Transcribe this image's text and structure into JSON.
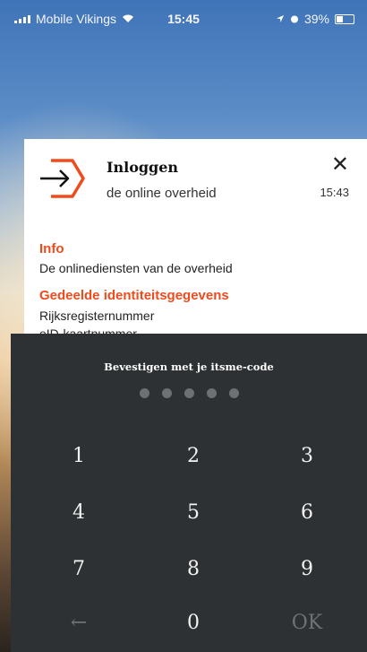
{
  "status_bar": {
    "carrier": "Mobile Vikings",
    "time": "15:45",
    "battery": "39%"
  },
  "notification": {
    "title": "Inloggen",
    "subtitle": "de online overheid",
    "time": "15:43",
    "close_symbol": "✕",
    "sections": [
      {
        "title": "Info",
        "text": "De onlinediensten van de overheid"
      },
      {
        "title": "Gedeelde identiteitsgegevens",
        "text": "Rijksregisternummer"
      }
    ],
    "partial_text": "eID-kaartnummer",
    "accent_color": "#f04b1c"
  },
  "keypad": {
    "title": "Bevestigen met je itsme-code",
    "pin_dots": 5,
    "keys": [
      "1",
      "2",
      "3",
      "4",
      "5",
      "6",
      "7",
      "8",
      "9",
      "←",
      "0",
      "OK"
    ]
  }
}
